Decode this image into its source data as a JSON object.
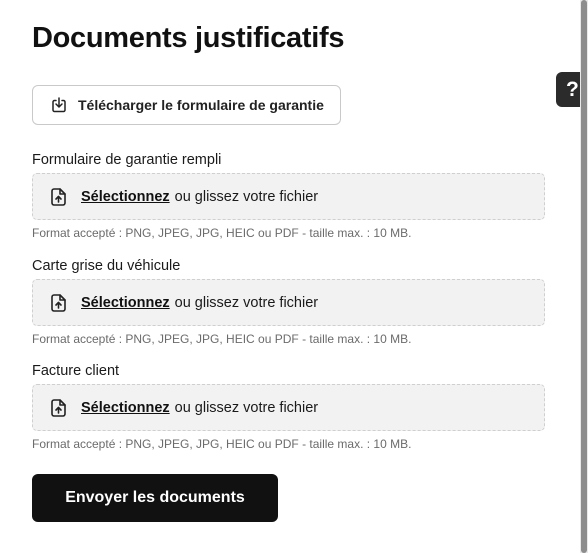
{
  "page": {
    "title": "Documents justificatifs"
  },
  "download": {
    "label": "Télécharger le formulaire de garantie",
    "icon": "download-icon"
  },
  "fields": [
    {
      "label": "Formulaire de garantie rempli",
      "select_text": "Sélectionnez",
      "drop_text": "ou glissez votre fichier",
      "hint": "Format accepté : PNG, JPEG, JPG, HEIC ou PDF - taille max. : 10 MB.",
      "icon": "file-upload-icon"
    },
    {
      "label": "Carte grise du véhicule",
      "select_text": "Sélectionnez",
      "drop_text": "ou glissez votre fichier",
      "hint": "Format accepté : PNG, JPEG, JPG, HEIC ou PDF - taille max. : 10 MB.",
      "icon": "file-upload-icon"
    },
    {
      "label": "Facture client",
      "select_text": "Sélectionnez",
      "drop_text": "ou glissez votre fichier",
      "hint": "Format accepté : PNG, JPEG, JPG, HEIC ou PDF - taille max. : 10 MB.",
      "icon": "file-upload-icon"
    }
  ],
  "submit": {
    "label": "Envoyer les documents"
  },
  "help": {
    "label": "?",
    "icon": "help-icon"
  },
  "colors": {
    "primary": "#111111",
    "dropzone_bg": "#f2f2f2",
    "border": "#cfcfcf",
    "hint": "#6b6b6b",
    "help_bg": "#2b2b2b"
  }
}
